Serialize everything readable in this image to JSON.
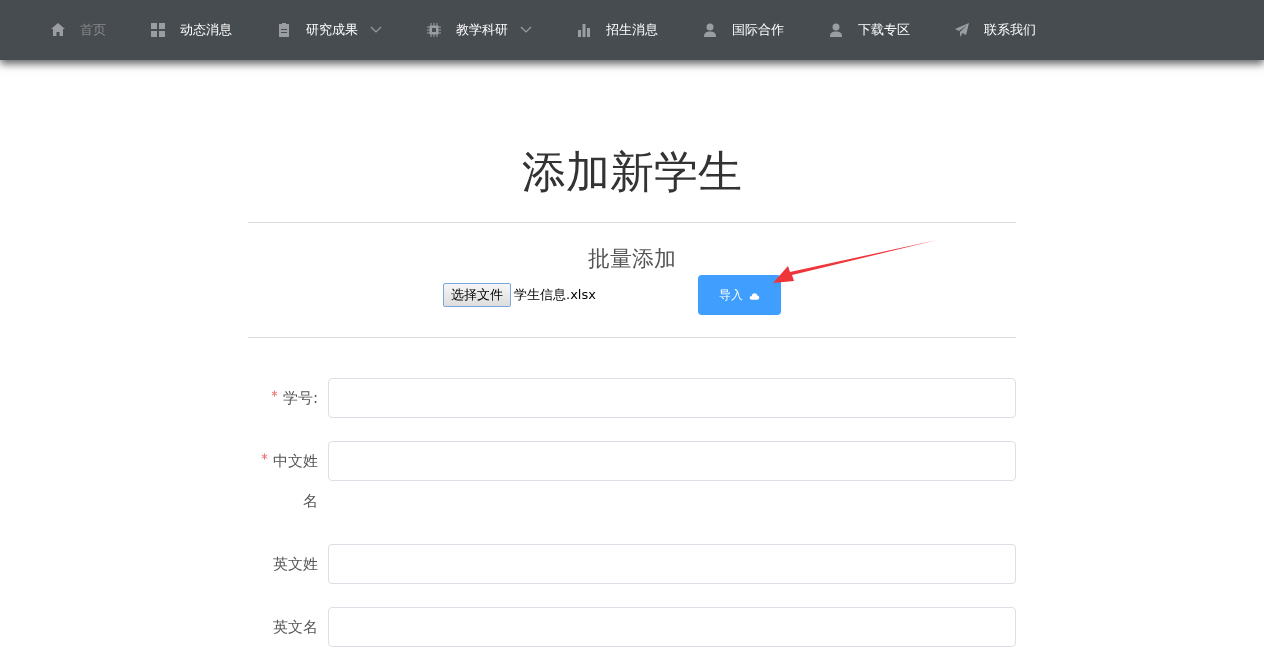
{
  "nav": {
    "items": [
      {
        "label": "首页",
        "selected": true,
        "dropdown": false
      },
      {
        "label": "动态消息",
        "selected": false,
        "dropdown": false
      },
      {
        "label": "研究成果",
        "selected": false,
        "dropdown": true
      },
      {
        "label": "教学科研",
        "selected": false,
        "dropdown": true
      },
      {
        "label": "招生消息",
        "selected": false,
        "dropdown": false
      },
      {
        "label": "国际合作",
        "selected": false,
        "dropdown": false
      },
      {
        "label": "下载专区",
        "selected": false,
        "dropdown": false
      },
      {
        "label": "联系我们",
        "selected": false,
        "dropdown": false
      }
    ]
  },
  "page_title": "添加新学生",
  "batch": {
    "title": "批量添加",
    "file_button": "选择文件",
    "file_name": "学生信息.xlsx",
    "import_button": "导入"
  },
  "form": {
    "fields": [
      {
        "label": "学号:",
        "required": true
      },
      {
        "label": "中文姓名",
        "required": true
      },
      {
        "label": "英文姓",
        "required": false
      },
      {
        "label": "英文名",
        "required": false
      }
    ]
  }
}
